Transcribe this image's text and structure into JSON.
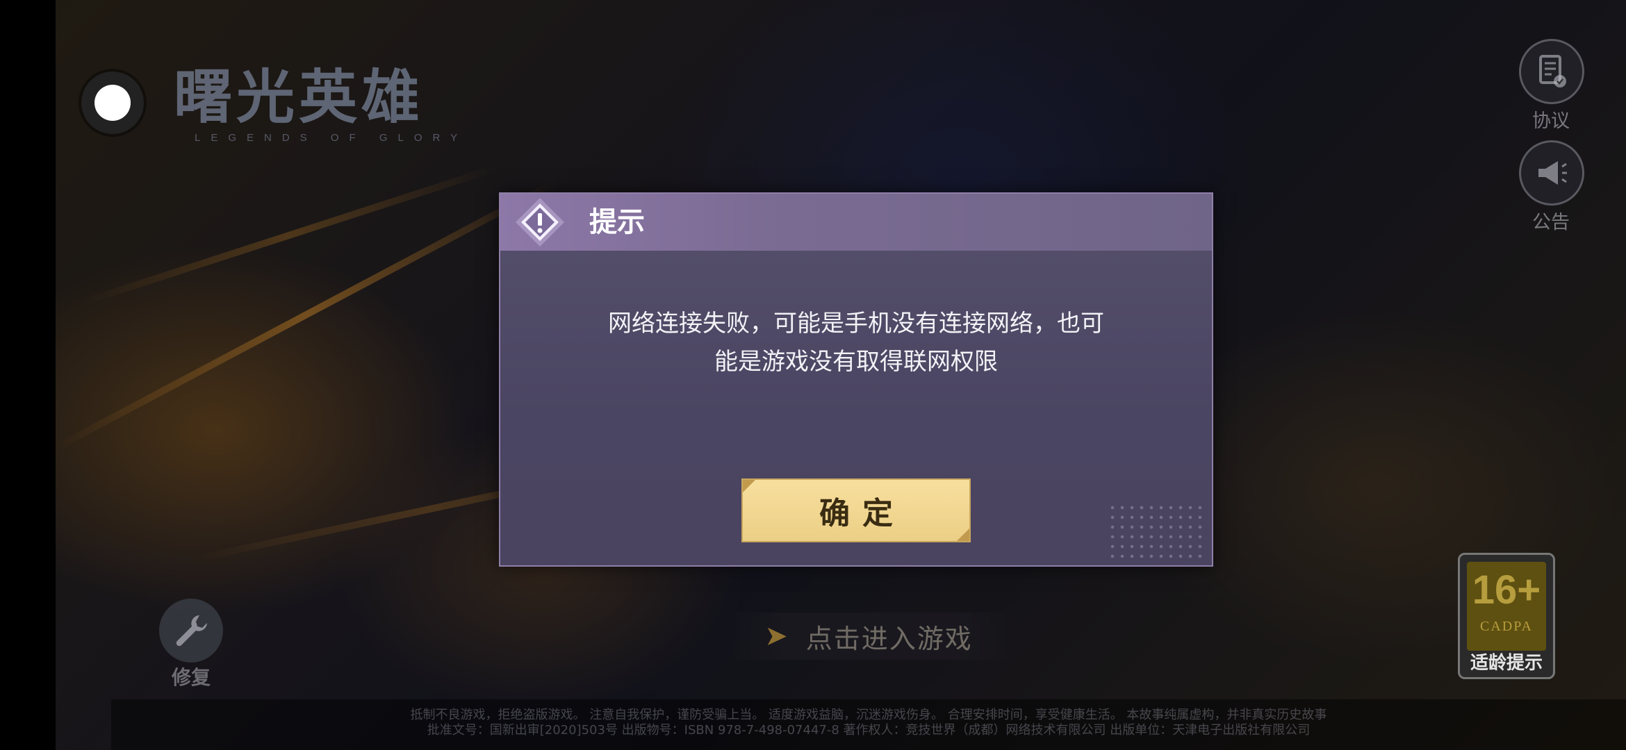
{
  "game": {
    "title": "曙光英雄",
    "subtitle": "LEGENDS OF GLORY"
  },
  "side_buttons": {
    "agreement": {
      "icon": "document-check-icon",
      "label": "协议"
    },
    "announcement": {
      "icon": "megaphone-icon",
      "label": "公告"
    }
  },
  "repair": {
    "icon": "wrench-icon",
    "label": "修复"
  },
  "enter_game": {
    "label": "点击进入游戏"
  },
  "age_rating": {
    "age": "16+",
    "org": "CADPA",
    "hint": "适龄提示"
  },
  "footer": {
    "line1": "抵制不良游戏，拒绝盗版游戏。 注意自我保护，谨防受骗上当。 适度游戏益脑，沉迷游戏伤身。 合理安排时间，享受健康生活。 本故事纯属虚构，并非真实历史故事",
    "line2": "批准文号：国新出审[2020]503号 出版物号：ISBN 978-7-498-07447-8 著作权人：竞技世界（成都）网络技术有限公司 出版单位：天津电子出版社有限公司"
  },
  "dialog": {
    "title": "提示",
    "message_line1": "网络连接失败，可能是手机没有连接网络，也可",
    "message_line2": "能是游戏没有取得联网权限",
    "confirm_label": "确定"
  },
  "colors": {
    "dialog_header": "#8d78a8",
    "dialog_body": "#4a4562",
    "confirm_button": "#f7df9e"
  }
}
